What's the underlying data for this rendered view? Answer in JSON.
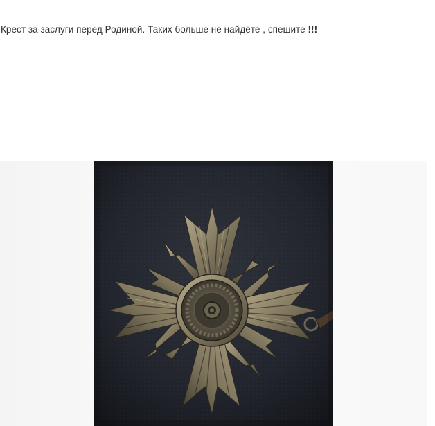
{
  "post": {
    "text": "Крест за заслуги перед Родиной. Таких больше не найдёте , спешите ",
    "emphasis": "!!!"
  },
  "image": {
    "subject": "medal-cross-image"
  },
  "colors": {
    "text": "#333333",
    "band_background": "#f6f6f6",
    "photo_background": "#1e2128",
    "medal_metal": "#8a8066"
  }
}
